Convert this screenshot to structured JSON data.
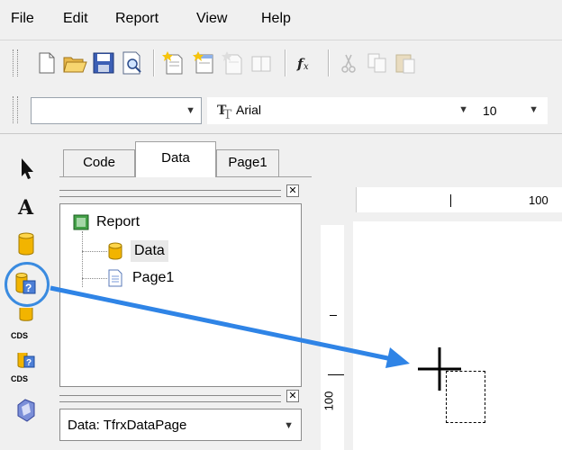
{
  "menu": {
    "items": [
      "File",
      "Edit",
      "Report",
      "View",
      "Help"
    ]
  },
  "toolbar_font": {
    "style_value": "",
    "font_name": "Arial",
    "font_size": "10"
  },
  "tabs": [
    "Code",
    "Data",
    "Page1"
  ],
  "active_tab": "Data",
  "tree": {
    "root": "Report",
    "children": [
      "Data",
      "Page1"
    ]
  },
  "ruler": {
    "top_label": "100",
    "left_label": "100"
  },
  "object_selector": {
    "value": "Data: TfrxDataPage"
  },
  "palette_labels": {
    "cds1": "CDS",
    "cds2": "CDS"
  },
  "colors": {
    "accent_arrow": "#2f84e6",
    "highlight_circle": "#3a8be0"
  }
}
